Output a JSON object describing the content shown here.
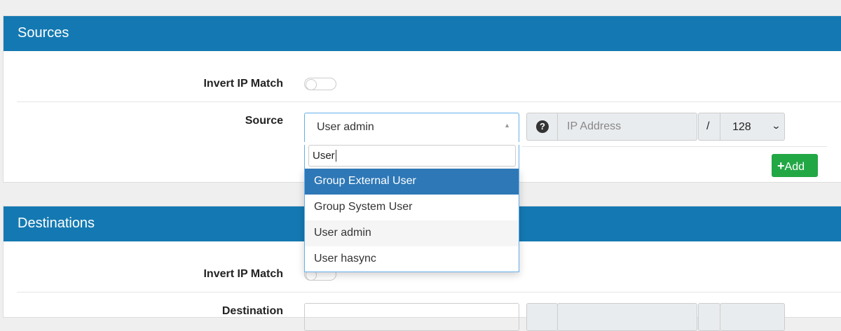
{
  "sources": {
    "title": "Sources",
    "invert_label": "Invert IP Match",
    "source_label": "Source",
    "selected": "User admin",
    "search_value": "User",
    "ip_placeholder": "IP Address",
    "slash": "/",
    "mask": "128",
    "add_label": "Add"
  },
  "dropdown": {
    "options": [
      "Group External User",
      "Group System User",
      "User admin",
      "User hasync"
    ]
  },
  "destinations": {
    "title": "Destinations",
    "invert_label": "Invert IP Match",
    "dest_label": "Destination"
  }
}
